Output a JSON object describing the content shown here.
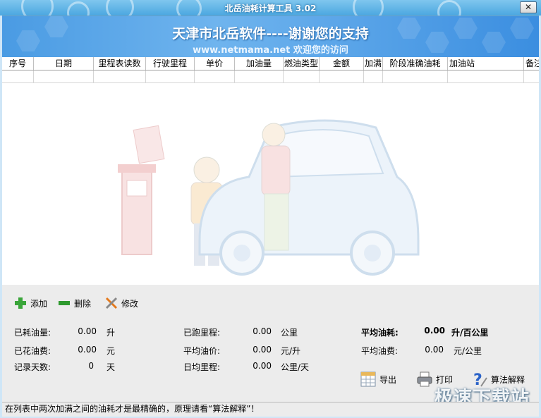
{
  "window": {
    "title": "北岳油耗计算工具 3.02",
    "close_glyph": "✕"
  },
  "banner": {
    "line1": "天津市北岳软件----谢谢您的支持",
    "line2": "www.netmama.net 欢迎您的访问"
  },
  "table": {
    "columns": [
      "序号",
      "日期",
      "里程表读数",
      "行驶里程",
      "单价",
      "加油量",
      "燃油类型",
      "金额",
      "加满",
      "阶段准确油耗",
      "加油站",
      "备注"
    ]
  },
  "toolbar": {
    "add": "添加",
    "delete": "删除",
    "edit": "修改"
  },
  "stats": {
    "fuel_used_label": "已耗油量:",
    "fuel_used_value": "0.00",
    "fuel_used_unit": "升",
    "fuel_cost_label": "已花油费:",
    "fuel_cost_value": "0.00",
    "fuel_cost_unit": "元",
    "days_label": "记录天数:",
    "days_value": "0",
    "days_unit": "天",
    "distance_label": "已跑里程:",
    "distance_value": "0.00",
    "distance_unit": "公里",
    "avg_price_label": "平均油价:",
    "avg_price_value": "0.00",
    "avg_price_unit": "元/升",
    "daily_label": "日均里程:",
    "daily_value": "0.00",
    "daily_unit": "公里/天",
    "avg_consumption_label": "平均油耗:",
    "avg_consumption_value": "0.00",
    "avg_consumption_unit": "升/百公里",
    "avg_cost_label": "平均油费:",
    "avg_cost_value": "0.00",
    "avg_cost_unit": "元/公里"
  },
  "actions": {
    "export": "导出",
    "print": "打印",
    "explain": "算法解释"
  },
  "status": {
    "text": "在列表中两次加满之间的油耗才是最精确的，原理请看“算法解释”！"
  },
  "overlay_logo": "极速下载站"
}
